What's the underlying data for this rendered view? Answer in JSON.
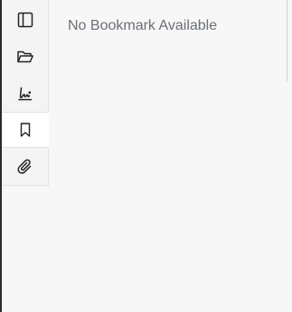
{
  "sidebar": {
    "items": [
      {
        "name": "panel-toggle",
        "icon": "sidebar-panel-icon",
        "active": false
      },
      {
        "name": "open-file",
        "icon": "folder-open-icon",
        "active": false
      },
      {
        "name": "signature",
        "icon": "signature-icon",
        "active": false
      },
      {
        "name": "bookmarks",
        "icon": "bookmark-icon",
        "active": true
      },
      {
        "name": "attachments",
        "icon": "paperclip-icon",
        "active": false
      }
    ]
  },
  "bookmark_panel": {
    "empty_message": "No Bookmark Available"
  },
  "colors": {
    "icon": "#222222",
    "message_text": "#6b7078",
    "active_background": "#ffffff",
    "rail_background": "#f4f4f4"
  }
}
